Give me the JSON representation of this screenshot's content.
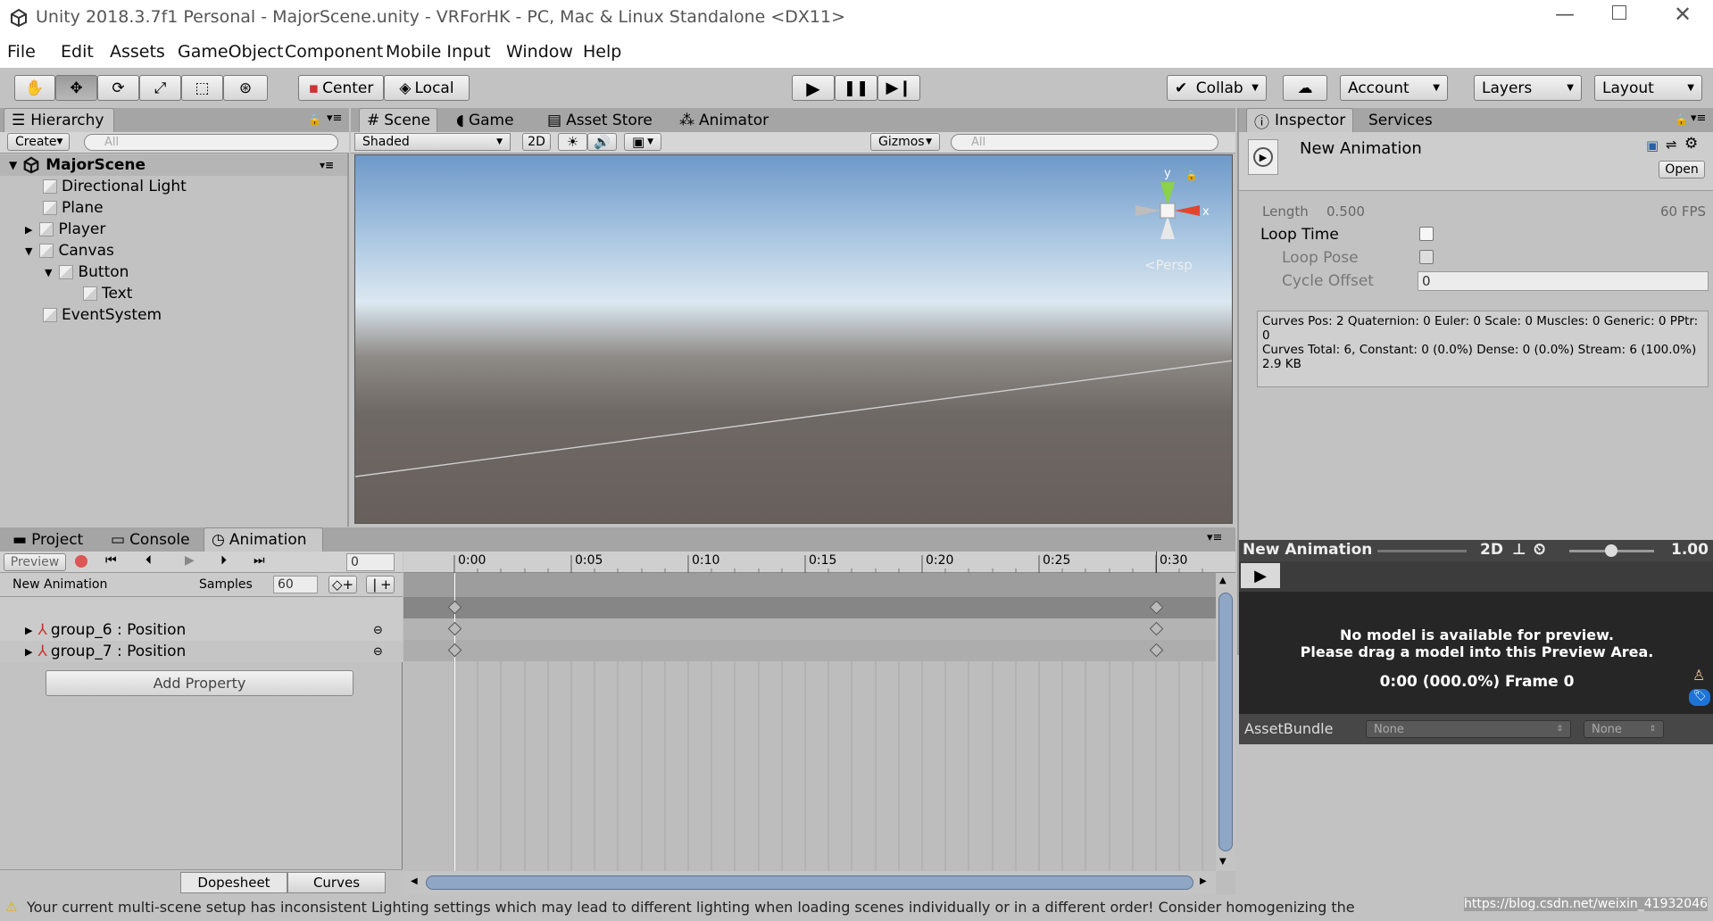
{
  "window": {
    "title": "Unity 2018.3.7f1 Personal - MajorScene.unity - VRForHK - PC, Mac & Linux Standalone <DX11>"
  },
  "menu": [
    "File",
    "Edit",
    "Assets",
    "GameObject",
    "Component",
    "Mobile Input",
    "Window",
    "Help"
  ],
  "toolbar": {
    "center": "Center",
    "local": "Local",
    "collab": "Collab",
    "account": "Account",
    "layers": "Layers",
    "layout": "Layout"
  },
  "hierarchy": {
    "tab": "Hierarchy",
    "create": "Create",
    "search_placeholder": "All",
    "scene": "MajorScene",
    "items": [
      "Directional Light",
      "Plane",
      "Player",
      "Canvas",
      "Button",
      "Text",
      "EventSystem"
    ]
  },
  "scene": {
    "tabs": [
      "Scene",
      "Game",
      "Asset Store",
      "Animator"
    ],
    "shading": "Shaded",
    "mode_2d": "2D",
    "gizmos": "Gizmos",
    "search_placeholder": "All",
    "persp": "Persp",
    "axis_y": "y",
    "axis_x": "x"
  },
  "inspector": {
    "tabs": [
      "Inspector",
      "Services"
    ],
    "asset_name": "New Animation",
    "open": "Open",
    "length_label": "Length",
    "length_value": "0.500",
    "fps": "60 FPS",
    "loop_time": "Loop Time",
    "loop_pose": "Loop Pose",
    "cycle_offset": "Cycle Offset",
    "cycle_offset_value": "0",
    "curves_info": "Curves Pos: 2 Quaternion: 0 Euler: 0 Scale: 0 Muscles: 0 Generic: 0 PPtr: 0\nCurves Total: 6, Constant: 0 (0.0%) Dense: 0 (0.0%) Stream: 6 (100.0%)\n2.9 KB",
    "preview_title": "New Animation",
    "preview_2d": "2D",
    "preview_speed": "1.00",
    "preview_msg1": "No model is available for preview.",
    "preview_msg2": "Please drag a model into this Preview Area.",
    "preview_frame": "0:00 (000.0%) Frame 0",
    "assetbundle": "AssetBundle",
    "ab_none1": "None",
    "ab_none2": "None"
  },
  "bottom": {
    "tabs": [
      "Project",
      "Console",
      "Animation"
    ],
    "preview": "Preview",
    "frame": "0",
    "clip": "New Animation",
    "samples_label": "Samples",
    "samples": "60",
    "tracks": [
      "group_6 : Position",
      "group_7 : Position"
    ],
    "add_property": "Add Property",
    "dopesheet": "Dopesheet",
    "curves": "Curves",
    "ruler": [
      "0:00",
      "0:05",
      "0:10",
      "0:15",
      "0:20",
      "0:25",
      "0:30"
    ]
  },
  "status": {
    "warning": "Your current multi-scene setup has inconsistent Lighting settings which may lead to different lighting when loading scenes individually or in a different order! Consider homogenizing the",
    "watermark": "https://blog.csdn.net/weixin_41932046"
  }
}
